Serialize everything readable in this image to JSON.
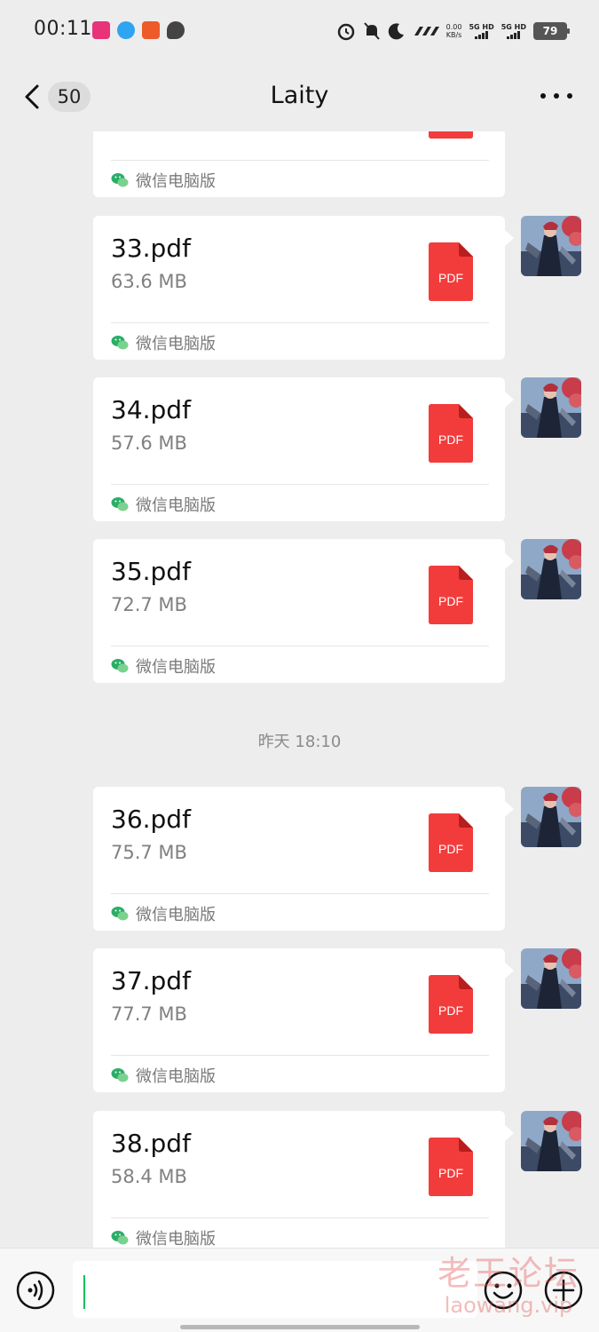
{
  "status_bar": {
    "time": "00:11",
    "net_speed_value": "0.00",
    "net_speed_unit": "KB/s",
    "sim1_label": "5G HD",
    "sim2_label": "5G HD",
    "battery": "79"
  },
  "header": {
    "unread_count": "50",
    "title": "Laity"
  },
  "messages": [
    {
      "file_name": "",
      "file_size": "",
      "source": "微信电脑版"
    },
    {
      "file_name": "33.pdf",
      "file_size": "63.6 MB",
      "source": "微信电脑版"
    },
    {
      "file_name": "34.pdf",
      "file_size": "57.6 MB",
      "source": "微信电脑版"
    },
    {
      "file_name": "35.pdf",
      "file_size": "72.7 MB",
      "source": "微信电脑版"
    },
    {
      "file_name": "36.pdf",
      "file_size": "75.7 MB",
      "source": "微信电脑版"
    },
    {
      "file_name": "37.pdf",
      "file_size": "77.7 MB",
      "source": "微信电脑版"
    },
    {
      "file_name": "38.pdf",
      "file_size": "58.4 MB",
      "source": "微信电脑版"
    }
  ],
  "pdf_badge_text": "PDF",
  "timestamp": "昨天 18:10",
  "watermark": {
    "cn": "老王论坛",
    "en": "laowang.vip"
  },
  "colors": {
    "accent_green": "#07c160",
    "pdf_red": "#f23c3c",
    "bubble": "#ffffff",
    "background": "#ededed"
  },
  "icons": [
    "back-arrow-icon",
    "more-dots-icon",
    "pdf-file-icon",
    "wechat-icon",
    "voice-icon",
    "emoji-icon",
    "plus-icon"
  ]
}
